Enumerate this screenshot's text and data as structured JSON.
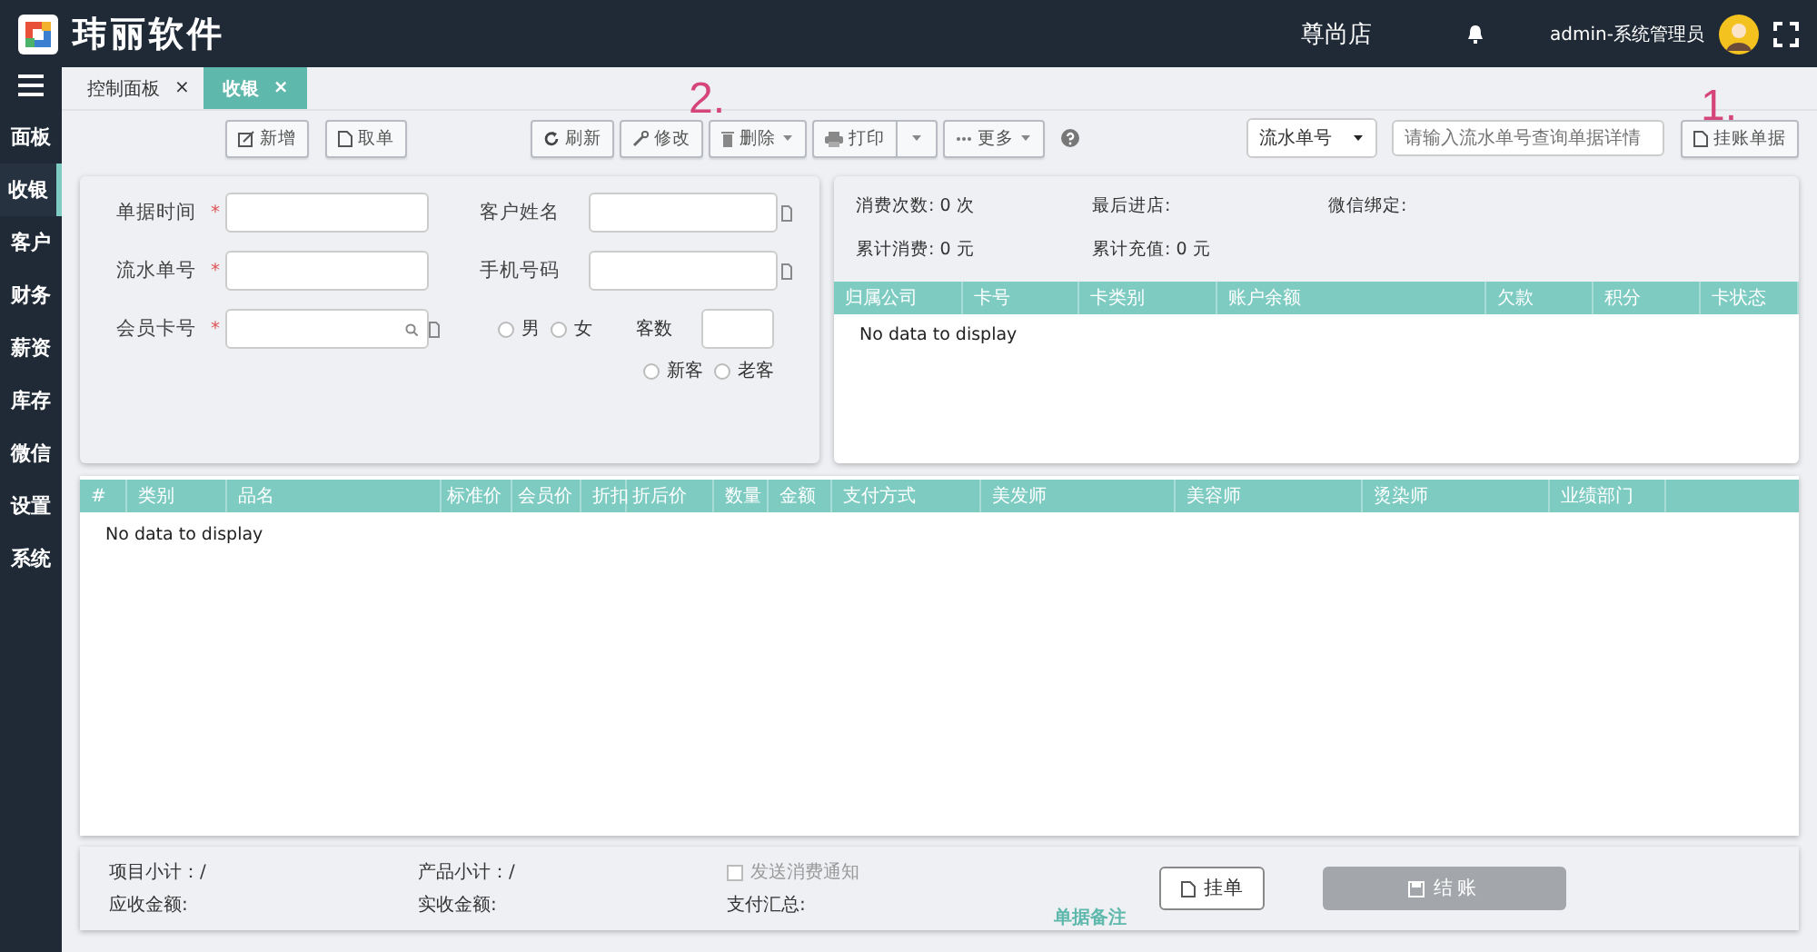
{
  "header": {
    "brand": "玮丽软件",
    "store": "尊尚店",
    "user": "admin-系统管理员"
  },
  "sidebar": {
    "items": [
      {
        "label": "面板",
        "selected": false
      },
      {
        "label": "收银",
        "selected": true
      },
      {
        "label": "客户",
        "selected": false
      },
      {
        "label": "财务",
        "selected": false
      },
      {
        "label": "薪资",
        "selected": false
      },
      {
        "label": "库存",
        "selected": false
      },
      {
        "label": "微信",
        "selected": false
      },
      {
        "label": "设置",
        "selected": false
      },
      {
        "label": "系统",
        "selected": false
      }
    ]
  },
  "tabs": [
    {
      "label": "控制面板",
      "selected": false,
      "close": "×"
    },
    {
      "label": "收银",
      "selected": true,
      "close": "×"
    }
  ],
  "toolbar": {
    "buttons": [
      {
        "label": "新增",
        "kind": "plain"
      },
      {
        "label": "取单",
        "kind": "plain"
      },
      {
        "label": "刷新",
        "kind": "plain"
      },
      {
        "label": "修改",
        "kind": "plain"
      },
      {
        "label": "删除",
        "kind": "menu"
      },
      {
        "label": "打印",
        "kind": "split"
      },
      {
        "label": "更多",
        "kind": "menu"
      }
    ],
    "search_type": "流水单号",
    "search": {
      "placeholder": "请输入流水单号查询单据详情"
    },
    "right_button": "挂账单据"
  },
  "form": {
    "fields": [
      {
        "label": "单据时间",
        "marker": "*",
        "kind": "text"
      },
      {
        "label": "客户姓名",
        "kind": "copy"
      },
      {
        "label": "流水单号",
        "marker": "*",
        "kind": "text"
      },
      {
        "label": "手机号码",
        "kind": "copy"
      },
      {
        "label": "会员卡号",
        "marker": "*",
        "kind": "search"
      }
    ],
    "gender": [
      {
        "label": "男",
        "selected": false
      },
      {
        "label": "女",
        "selected": false
      }
    ],
    "guests_label": "客数",
    "customer_type": [
      {
        "label": "新客",
        "selected": false
      },
      {
        "label": "老客",
        "selected": false
      }
    ]
  },
  "member": {
    "stats": [
      "消费次数: 0 次",
      "最后进店:",
      "微信绑定:",
      "累计消费: 0 元",
      "累计充值: 0 元"
    ],
    "columns": [
      "归属公司",
      "卡号",
      "卡类别",
      "账户余额",
      "欠款",
      "积分",
      "卡状态"
    ],
    "empty": "No data to display"
  },
  "items_table": {
    "columns": [
      "#",
      "类别",
      "品名",
      "标准价",
      "会员价",
      "折扣",
      "折后价",
      "数量",
      "金额",
      "支付方式",
      "美发师",
      "美容师",
      "烫染师",
      "业绩部门"
    ],
    "empty": "No data to display"
  },
  "footer": {
    "summary": [
      "项目小计：/",
      "产品小计：/",
      "应收金额:",
      "实收金额:",
      "支付汇总:"
    ],
    "notify": {
      "label": "发送消费通知",
      "checked": false
    },
    "note_link": "单据备注",
    "hold_button": "挂单",
    "checkout_button": "结账"
  },
  "annotations": [
    "2.",
    "1."
  ]
}
